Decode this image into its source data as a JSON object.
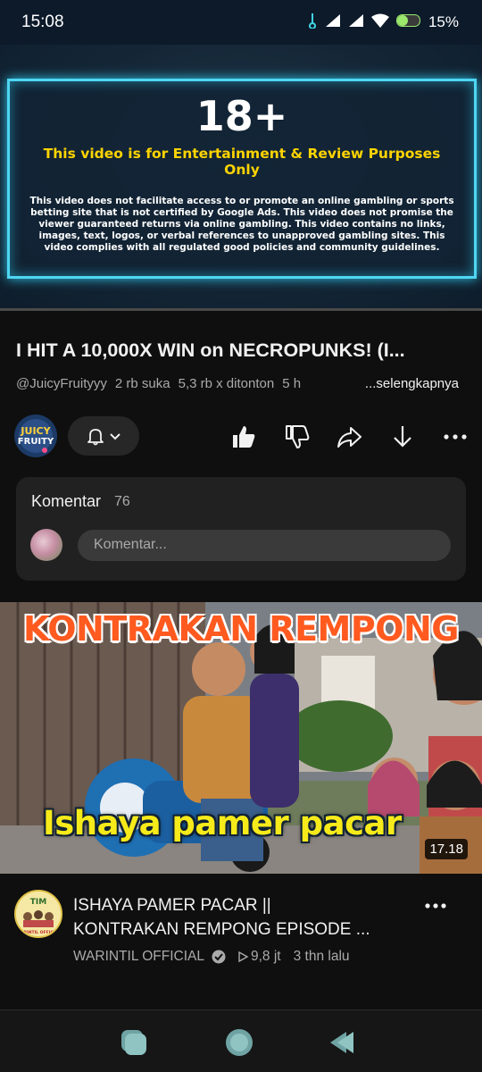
{
  "status_bar": {
    "time": "15:08",
    "battery": "15%"
  },
  "player": {
    "notice_age": "18+",
    "notice_subtitle": "This video is for Entertainment & Review Purposes Only",
    "notice_body": "This video does not facilitate access to or promote an online gambling or sports betting site that is not certified by Google Ads. This video does not promise the viewer guaranteed returns via online gambling. This video contains no links, images, text, logos, or verbal references to unapproved gambling sites. This video complies with all regulated good policies and community guidelines.",
    "progress_percent": 0
  },
  "video": {
    "title": "I HIT A 10,000X WIN on NECROPUNKS! (I...",
    "channel": "@JuicyFruityyy",
    "likes": "2 rb suka",
    "views": "5,3 rb x ditonton",
    "age_partial": "5 h",
    "more_label": "...selengkapnya",
    "channel_avatar_text_1": "JUICY",
    "channel_avatar_text_2": "FRUITY"
  },
  "comments": {
    "label": "Komentar",
    "count": "76",
    "placeholder": "Komentar..."
  },
  "next_video": {
    "thumb_title": "KONTRAKAN REMPONG",
    "thumb_caption": "Ishaya pamer pacar",
    "duration": "17.18",
    "title_line1": "ISHAYA PAMER PACAR ||",
    "title_line2": "KONTRAKAN REMPONG EPISODE ...",
    "channel": "WARINTIL OFFICIAL",
    "views": "9,8 jt",
    "age": "3 thn lalu",
    "avatar_text": "WARINTIL OFFICIAL",
    "avatar_big": "TIM"
  },
  "colors": {
    "accent_cyan": "#4fd6f2",
    "warn_yellow": "#ffd400",
    "thumb_orange": "#ff5a1f",
    "caption_yellow": "#f6ea1a"
  }
}
